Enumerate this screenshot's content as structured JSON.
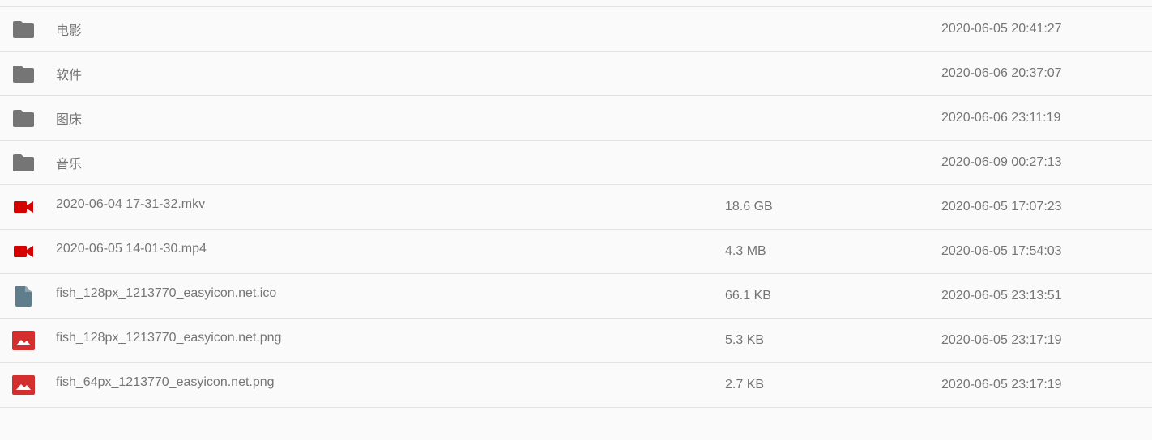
{
  "colors": {
    "folder_icon": "#757575",
    "video_icon": "#d50000",
    "doc_icon": "#607d8b",
    "image_icon": "#d32f2f",
    "text": "#757575",
    "divider": "#e3e3e3",
    "background": "#fafafa"
  },
  "files": [
    {
      "type": "folder",
      "icon": "folder-icon",
      "name": "电影",
      "size": "",
      "date": "2020-06-05 20:41:27"
    },
    {
      "type": "folder",
      "icon": "folder-icon",
      "name": "软件",
      "size": "",
      "date": "2020-06-06 20:37:07"
    },
    {
      "type": "folder",
      "icon": "folder-icon",
      "name": "图床",
      "size": "",
      "date": "2020-06-06 23:11:19"
    },
    {
      "type": "folder",
      "icon": "folder-icon",
      "name": "音乐",
      "size": "",
      "date": "2020-06-09 00:27:13"
    },
    {
      "type": "video",
      "icon": "video-camera-icon",
      "name": "2020-06-04 17-31-32.mkv",
      "size": "18.6 GB",
      "date": "2020-06-05 17:07:23"
    },
    {
      "type": "video",
      "icon": "video-camera-icon",
      "name": "2020-06-05 14-01-30.mp4",
      "size": "4.3 MB",
      "date": "2020-06-05 17:54:03"
    },
    {
      "type": "doc",
      "icon": "file-icon",
      "name": "fish_128px_1213770_easyicon.net.ico",
      "size": "66.1 KB",
      "date": "2020-06-05 23:13:51"
    },
    {
      "type": "image",
      "icon": "image-icon",
      "name": "fish_128px_1213770_easyicon.net.png",
      "size": "5.3 KB",
      "date": "2020-06-05 23:17:19"
    },
    {
      "type": "image",
      "icon": "image-icon",
      "name": "fish_64px_1213770_easyicon.net.png",
      "size": "2.7 KB",
      "date": "2020-06-05 23:17:19"
    }
  ]
}
